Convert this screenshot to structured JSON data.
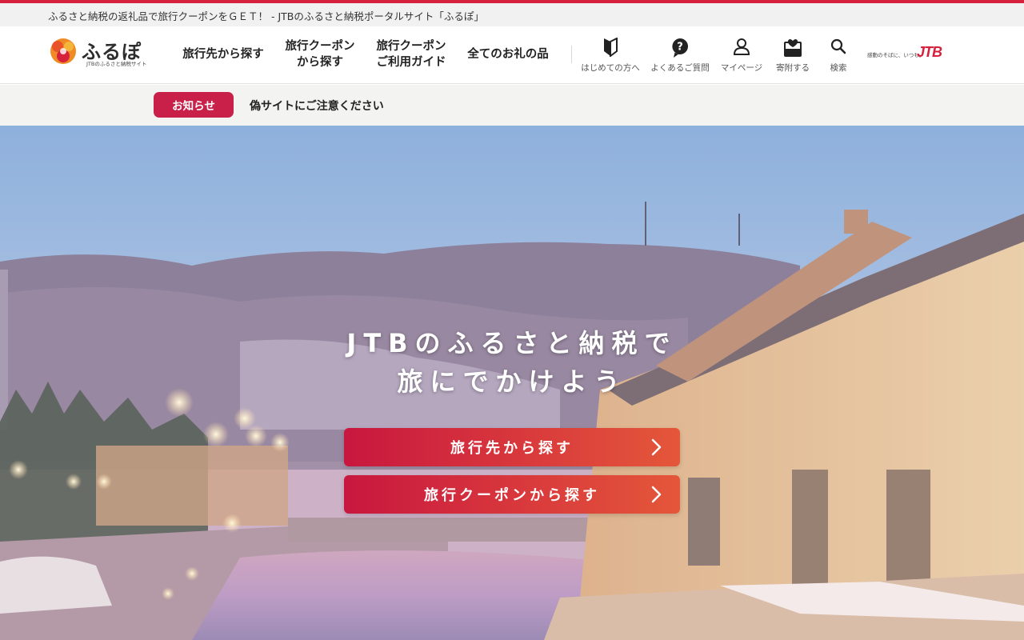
{
  "tagline": "ふるさと納税の返礼品で旅行クーポンをＧＥＴ！ - JTBのふるさと納税ポータルサイト「ふるぽ」",
  "logo": {
    "name": "ふるぽ",
    "subtitle": "JTBのふるさと納税サイト"
  },
  "nav": [
    {
      "label": "旅行先から探す"
    },
    {
      "label_line1": "旅行クーポン",
      "label_line2": "から探す"
    },
    {
      "label_line1": "旅行クーポン",
      "label_line2": "ご利用ガイド"
    },
    {
      "label": "全てのお礼の品"
    }
  ],
  "utility": [
    {
      "label": "はじめての方へ",
      "icon": "beginner-mark-icon"
    },
    {
      "label": "よくあるご質問",
      "icon": "question-icon"
    },
    {
      "label": "マイページ",
      "icon": "user-icon"
    },
    {
      "label": "寄附する",
      "icon": "donate-icon"
    },
    {
      "label": "検索",
      "icon": "search-icon"
    }
  ],
  "jtb": {
    "slogan": "感動のそばに、いつも。",
    "logo": "JTB"
  },
  "notice": {
    "badge": "お知らせ",
    "text": "偽サイトにご注意ください"
  },
  "hero": {
    "title_line1": "JTBのふるさと納税で",
    "title_line2": "旅にでかけよう",
    "cta_primary": "旅行先から探す",
    "cta_secondary": "旅行クーポンから探す"
  },
  "colors": {
    "brand_red": "#c9204a",
    "accent_orange": "#e4573a"
  }
}
